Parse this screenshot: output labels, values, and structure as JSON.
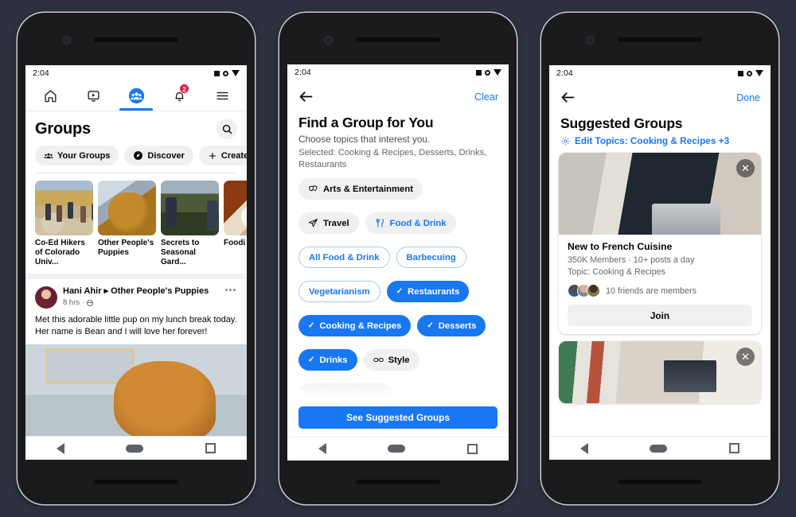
{
  "background_color": "#2e3240",
  "accent_color": "#1877f2",
  "status_bar": {
    "time": "2:04"
  },
  "android_nav": {
    "back": "back-triangle",
    "home": "home-pill",
    "recents": "recents-square"
  },
  "phone1": {
    "tabs": [
      {
        "name": "home",
        "icon": "home-icon",
        "active": false
      },
      {
        "name": "watch",
        "icon": "video-icon",
        "active": false
      },
      {
        "name": "groups",
        "icon": "groups-icon",
        "active": true
      },
      {
        "name": "notifications",
        "icon": "bell-icon",
        "active": false,
        "badge": "2"
      },
      {
        "name": "menu",
        "icon": "hamburger-menu-icon",
        "active": false
      }
    ],
    "header": {
      "title": "Groups",
      "search_icon": "search-icon"
    },
    "filter_chips": [
      {
        "label": "Your Groups",
        "icon": "people-icon"
      },
      {
        "label": "Discover",
        "icon": "compass-icon"
      },
      {
        "label": "Create",
        "icon": "plus-icon"
      }
    ],
    "group_thumbs": [
      {
        "caption": "Co-Ed Hikers of Colorado Univ...",
        "photo": "ph-hikers"
      },
      {
        "caption": "Other People's Puppies",
        "photo": "ph-dog"
      },
      {
        "caption": "Secrets to Seasonal Gard...",
        "photo": "ph-garden"
      },
      {
        "caption": "Foodi Denve",
        "photo": "ph-food"
      }
    ],
    "post": {
      "author": "Hani Ahir",
      "arrow": "▸",
      "group": "Other People's Puppies",
      "time": "8 hrs",
      "dot": "·",
      "privacy_icon": "globe-icon",
      "more_icon": "more-options-icon",
      "text": "Met this adorable little pup on my lunch break today. Her name is Bean and I will love her forever!",
      "photo": "ph-puppost"
    }
  },
  "phone2": {
    "back_icon": "back-arrow-icon",
    "clear_label": "Clear",
    "title": "Find a Group for You",
    "subtitle": "Choose topics that interest you.",
    "selected_line": "Selected: Cooking & Recipes, Desserts, Drinks, Restaurants",
    "topic_chips": [
      {
        "label": "Arts & Entertainment",
        "state": "grey",
        "icon": "theater-masks-icon"
      },
      {
        "label": "Travel",
        "state": "grey",
        "icon": "paper-plane-icon"
      },
      {
        "label": "Food & Drink",
        "state": "grey-blue",
        "icon": "fork-knife-icon"
      },
      {
        "label": "All Food & Drink",
        "state": "outline",
        "icon": ""
      },
      {
        "label": "Barbecuing",
        "state": "outline",
        "icon": ""
      },
      {
        "label": "Vegetarianism",
        "state": "outline",
        "icon": ""
      },
      {
        "label": "Restaurants",
        "state": "selected",
        "icon": "check-icon"
      },
      {
        "label": "Cooking & Recipes",
        "state": "selected",
        "icon": "check-icon"
      },
      {
        "label": "Desserts",
        "state": "selected",
        "icon": "check-icon"
      },
      {
        "label": "Drinks",
        "state": "selected",
        "icon": "check-icon"
      },
      {
        "label": "Style",
        "state": "grey",
        "icon": "sunglasses-icon"
      },
      {
        "label": "",
        "state": "grey",
        "icon": ""
      }
    ],
    "cta_label": "See Suggested Groups"
  },
  "phone3": {
    "back_icon": "back-arrow-icon",
    "done_label": "Done",
    "title": "Suggested Groups",
    "edit_topics": {
      "icon": "gear-icon",
      "label": "Edit Topics: Cooking & Recipes +3"
    },
    "cards": [
      {
        "photo": "ph-cook",
        "close_icon": "close-icon",
        "close_glyph": "✕",
        "title": "New to French Cuisine",
        "meta_line1": "350K Members · 10+ posts a day",
        "meta_line2": "Topic: Cooking & Recipes",
        "friends_text": "10 friends are members",
        "faces": [
          "ph-f1",
          "ph-f2",
          "ph-f3"
        ],
        "join_label": "Join"
      },
      {
        "photo": "ph-cook2",
        "close_icon": "close-icon",
        "close_glyph": "✕"
      }
    ]
  }
}
